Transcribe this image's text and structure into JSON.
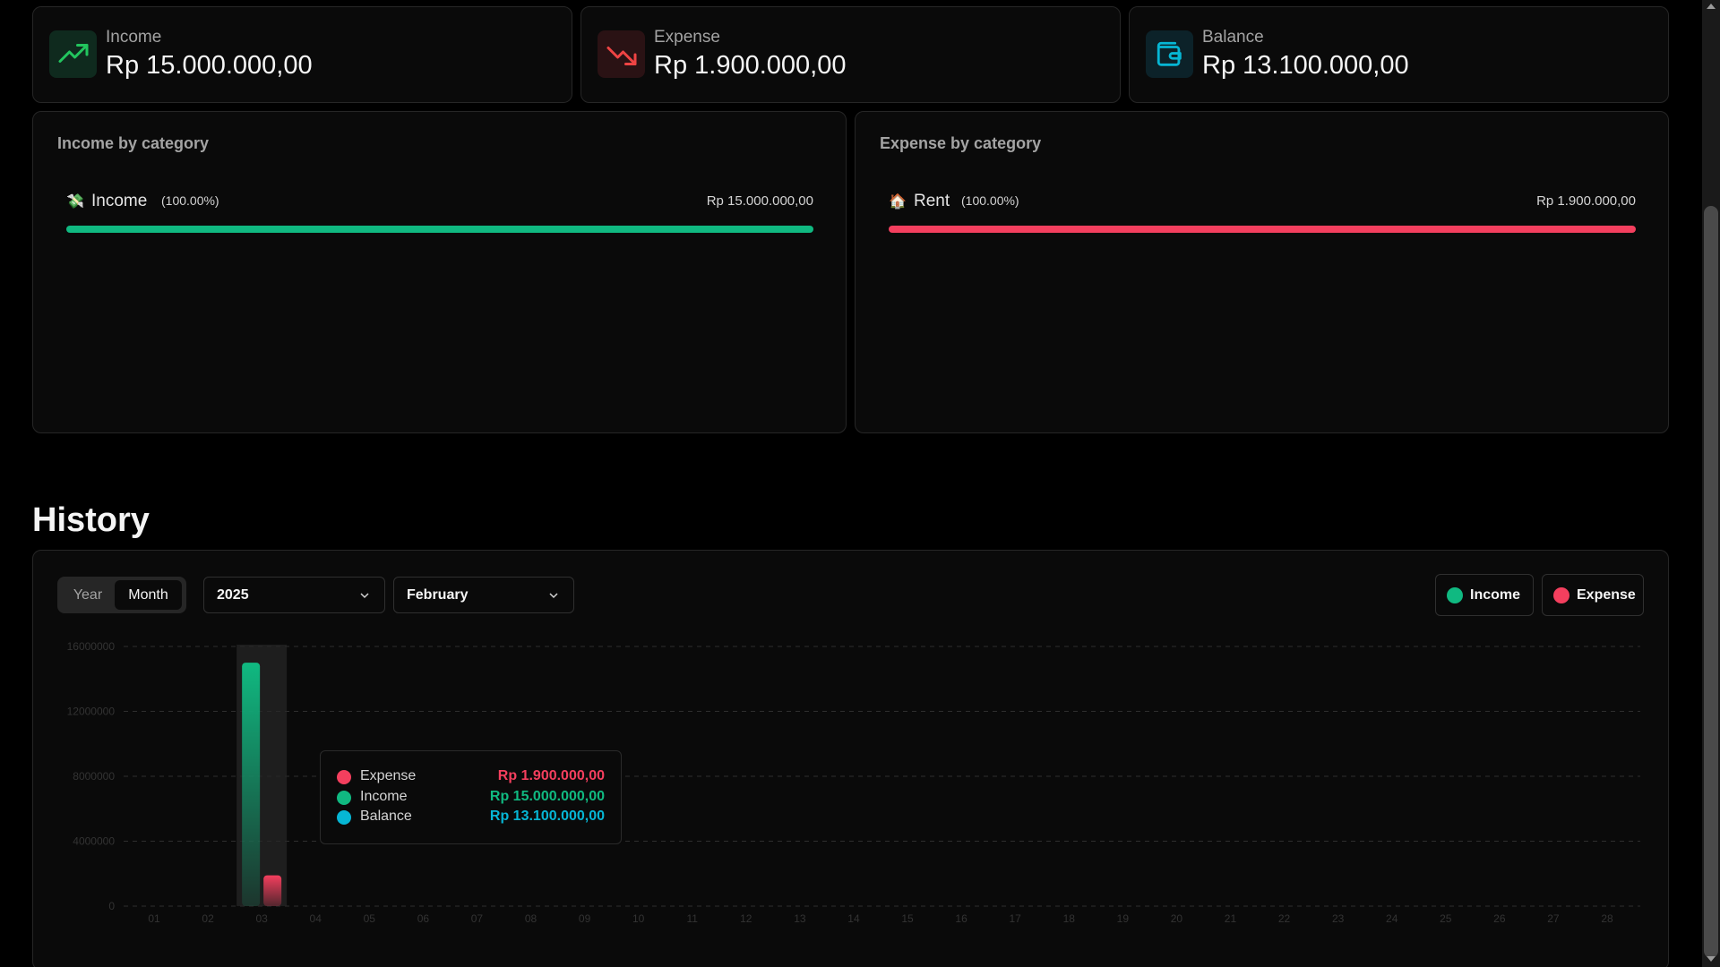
{
  "summary": {
    "income": {
      "label": "Income",
      "value": "Rp 15.000.000,00",
      "icon": "trending-up-icon",
      "color": "#22c55e"
    },
    "expense": {
      "label": "Expense",
      "value": "Rp 1.900.000,00",
      "icon": "trending-down-icon",
      "color": "#ef4444"
    },
    "balance": {
      "label": "Balance",
      "value": "Rp 13.100.000,00",
      "icon": "wallet-icon",
      "color": "#06b6d4"
    }
  },
  "income_by_category": {
    "title": "Income by category",
    "items": [
      {
        "emoji": "💸",
        "name": "Income",
        "percent": "(100.00%)",
        "amount": "Rp 15.000.000,00",
        "fraction": 1.0
      }
    ],
    "bar_color": "#10b981"
  },
  "expense_by_category": {
    "title": "Expense by category",
    "items": [
      {
        "emoji": "🏠",
        "name": "Rent",
        "percent": "(100.00%)",
        "amount": "Rp 1.900.000,00",
        "fraction": 1.0
      }
    ],
    "bar_color": "#f43f5e"
  },
  "history": {
    "title": "History",
    "toggle": {
      "year": "Year",
      "month": "Month",
      "active": "Month"
    },
    "year_select": "2025",
    "month_select": "February",
    "legend": [
      {
        "label": "Income",
        "color": "#10b981"
      },
      {
        "label": "Expense",
        "color": "#f43f5e"
      }
    ],
    "tooltip": {
      "rows": [
        {
          "name": "Expense",
          "value": "Rp 1.900.000,00",
          "color": "#f43f5e"
        },
        {
          "name": "Income",
          "value": "Rp 15.000.000,00",
          "color": "#10b981"
        },
        {
          "name": "Balance",
          "value": "Rp 13.100.000,00",
          "color": "#06b6d4"
        }
      ]
    }
  },
  "chart_data": {
    "type": "bar",
    "categories": [
      "01",
      "02",
      "03",
      "04",
      "05",
      "06",
      "07",
      "08",
      "09",
      "10",
      "11",
      "12",
      "13",
      "14",
      "15",
      "16",
      "17",
      "18",
      "19",
      "20",
      "21",
      "22",
      "23",
      "24",
      "25",
      "26",
      "27",
      "28"
    ],
    "yticks": [
      "16000000",
      "12000000",
      "8000000",
      "4000000",
      "0"
    ],
    "ylim": [
      0,
      16000000
    ],
    "highlight_index": 2,
    "series": [
      {
        "name": "Income",
        "color": "#10b981",
        "values": [
          0,
          0,
          15000000,
          0,
          0,
          0,
          0,
          0,
          0,
          0,
          0,
          0,
          0,
          0,
          0,
          0,
          0,
          0,
          0,
          0,
          0,
          0,
          0,
          0,
          0,
          0,
          0,
          0
        ]
      },
      {
        "name": "Expense",
        "color": "#f43f5e",
        "values": [
          0,
          0,
          1900000,
          0,
          0,
          0,
          0,
          0,
          0,
          0,
          0,
          0,
          0,
          0,
          0,
          0,
          0,
          0,
          0,
          0,
          0,
          0,
          0,
          0,
          0,
          0,
          0,
          0
        ]
      }
    ]
  }
}
